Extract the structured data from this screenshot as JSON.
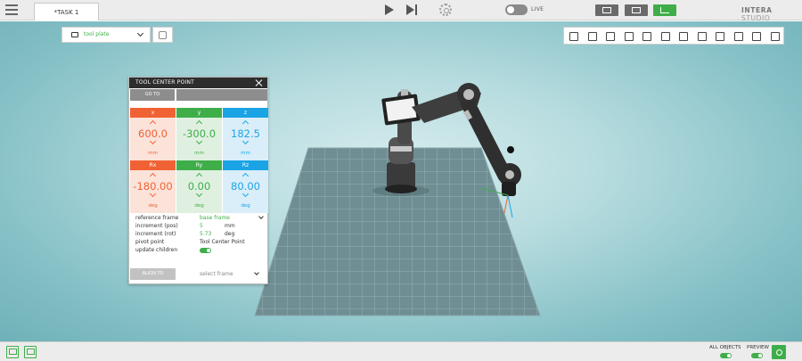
{
  "header": {
    "task_tab": "*TASK 1",
    "live_label": "LIVE",
    "brand_main": "INTERA",
    "brand_sub": "STUDIO"
  },
  "toolbar": {
    "frame_select": "tool plate"
  },
  "tcp_panel": {
    "title": "TOOL CENTER POINT",
    "goto_label": "GO TO",
    "coords": [
      {
        "label": "x",
        "value": "600.0",
        "unit": "mm"
      },
      {
        "label": "y",
        "value": "-300.0",
        "unit": "mm"
      },
      {
        "label": "z",
        "value": "182.5",
        "unit": "mm"
      },
      {
        "label": "Rx",
        "value": "-180.00",
        "unit": "deg"
      },
      {
        "label": "Ry",
        "value": "0.00",
        "unit": "deg"
      },
      {
        "label": "Rz",
        "value": "80.00",
        "unit": "deg"
      }
    ],
    "props": {
      "reference_frame_label": "reference frame",
      "reference_frame_value": "base frame",
      "increment_pos_label": "increment (pos)",
      "increment_pos_value": "5",
      "increment_pos_unit": "mm",
      "increment_rot_label": "increment (rot)",
      "increment_rot_value": "5.73",
      "increment_rot_unit": "deg",
      "pivot_label": "pivot point",
      "pivot_value": "Tool Center Point",
      "update_children_label": "update children",
      "update_children_on": true
    },
    "align_label": "ALIGN TO",
    "select_frame_placeholder": "select frame"
  },
  "footer": {
    "all_objects_label": "ALL OBJECTS",
    "preview_label": "PREVIEW"
  },
  "colors": {
    "accent_green": "#3fae49",
    "x_red": "#f06233",
    "z_blue": "#1ba4e5"
  }
}
